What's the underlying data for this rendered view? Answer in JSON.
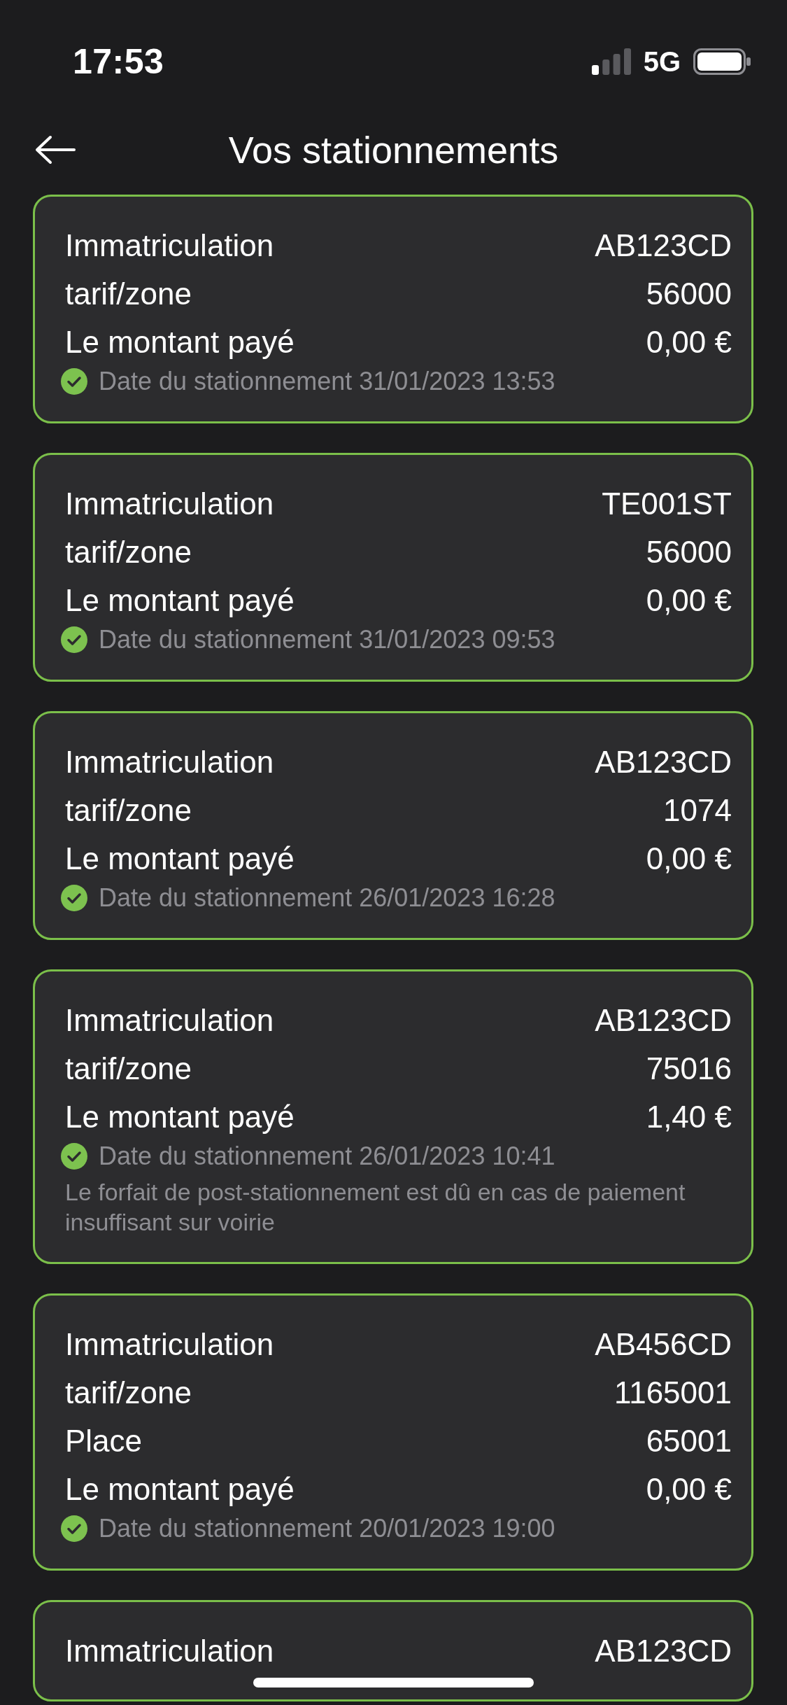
{
  "status_bar": {
    "time": "17:53",
    "network": "5G"
  },
  "header": {
    "title": "Vos stationnements"
  },
  "parkings": [
    {
      "rows": [
        {
          "label": "Immatriculation",
          "value": "AB123CD"
        },
        {
          "label": "tarif/zone",
          "value": "56000"
        },
        {
          "label": "Le montant payé",
          "value": "0,00 €"
        }
      ],
      "date": "Date du stationnement 31/01/2023 13:53"
    },
    {
      "rows": [
        {
          "label": "Immatriculation",
          "value": "TE001ST"
        },
        {
          "label": "tarif/zone",
          "value": "56000"
        },
        {
          "label": "Le montant payé",
          "value": "0,00 €"
        }
      ],
      "date": "Date du stationnement 31/01/2023 09:53"
    },
    {
      "rows": [
        {
          "label": "Immatriculation",
          "value": "AB123CD"
        },
        {
          "label": "tarif/zone",
          "value": "1074"
        },
        {
          "label": "Le montant payé",
          "value": "0,00 €"
        }
      ],
      "date": "Date du stationnement 26/01/2023 16:28"
    },
    {
      "rows": [
        {
          "label": "Immatriculation",
          "value": "AB123CD"
        },
        {
          "label": "tarif/zone",
          "value": "75016"
        },
        {
          "label": "Le montant payé",
          "value": "1,40 €"
        }
      ],
      "date": "Date du stationnement 26/01/2023 10:41",
      "note": "Le forfait de post-stationnement est dû en cas de paiement insuffisant sur voirie"
    },
    {
      "rows": [
        {
          "label": "Immatriculation",
          "value": "AB456CD"
        },
        {
          "label": "tarif/zone",
          "value": "1165001"
        },
        {
          "label": "Place",
          "value": "65001"
        },
        {
          "label": "Le montant payé",
          "value": "0,00 €"
        }
      ],
      "date": "Date du stationnement 20/01/2023 19:00"
    },
    {
      "rows": [
        {
          "label": "Immatriculation",
          "value": "AB123CD"
        }
      ]
    }
  ]
}
